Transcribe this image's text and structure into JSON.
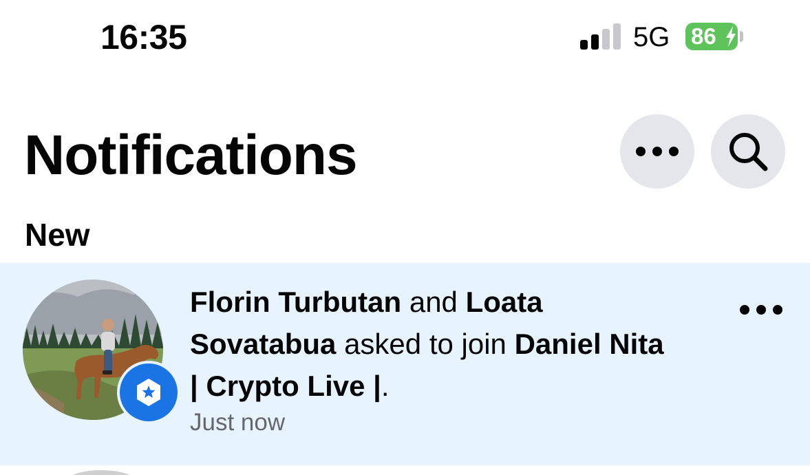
{
  "status_bar": {
    "time": "16:35",
    "network": "5G",
    "battery_level": "86",
    "signal_bars_active": 2,
    "signal_bars_total": 4,
    "battery_color": "#5ec35b"
  },
  "header": {
    "title": "Notifications",
    "more_icon": "more-horizontal-icon",
    "search_icon": "search-icon"
  },
  "section": {
    "label": "New"
  },
  "notification": {
    "actor_1": "Florin Turbutan",
    "connector_1": "and",
    "actor_2": "Loata Sovatabua",
    "action": "asked to join",
    "group_name": "Daniel Nita | Crypto Live |",
    "end_punctuation": ".",
    "time": "Just now",
    "badge_icon": "group-star-icon",
    "unread_background": "#e7f3ff"
  }
}
